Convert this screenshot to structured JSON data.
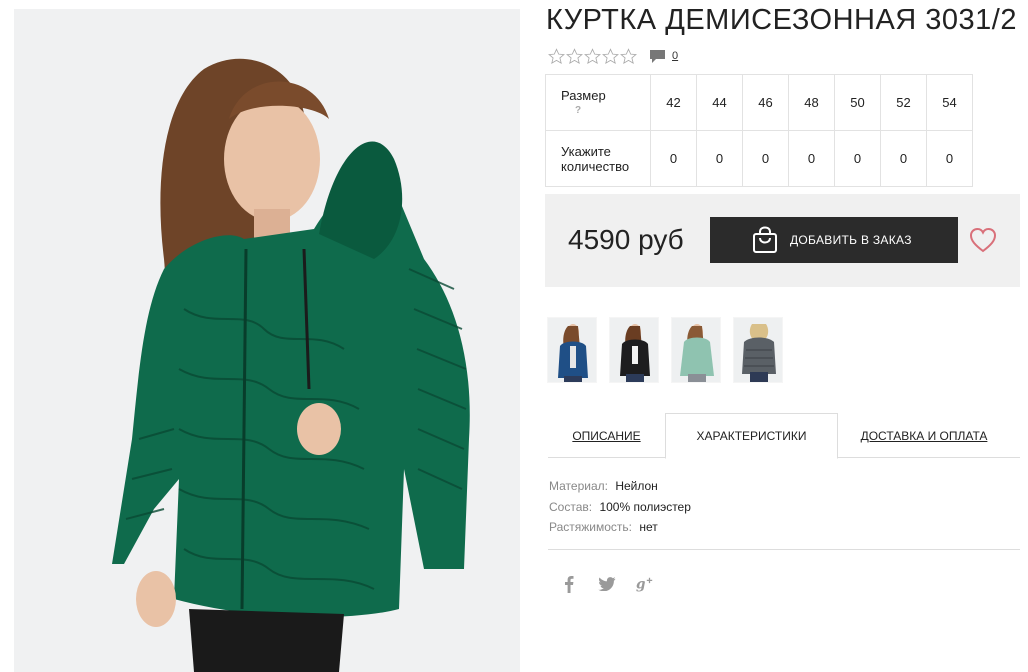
{
  "product": {
    "title": "КУРТКА ДЕМИСЕЗОННАЯ 3031/2",
    "comments_count": "0"
  },
  "sizes": {
    "size_label": "Размер",
    "size_hint": "?",
    "qty_label_line1": "Укажите",
    "qty_label_line2": "количество",
    "values": [
      "42",
      "44",
      "46",
      "48",
      "50",
      "52",
      "54"
    ],
    "quantities": [
      "0",
      "0",
      "0",
      "0",
      "0",
      "0",
      "0"
    ]
  },
  "price": {
    "amount": "4590 руб",
    "add_button_label": "ДОБАВИТЬ В ЗАКАЗ"
  },
  "tabs": {
    "description": "ОПИСАНИЕ",
    "characteristics": "ХАРАКТЕРИСТИКИ",
    "delivery": "ДОСТАВКА И ОПЛАТА"
  },
  "specs": [
    {
      "label": "Материал:",
      "value": "Нейлон"
    },
    {
      "label": "Состав:",
      "value": "100% полиэстер"
    },
    {
      "label": "Растяжимость:",
      "value": "нет"
    }
  ],
  "colors": {
    "jacket_green": "#0f6b4c",
    "jacket_green_dark": "#0a4a34",
    "button_dark": "#2b2b2b",
    "price_box_bg": "#f0f0f0",
    "heart": "#d9707a"
  },
  "icons": {
    "stars": [
      "star-outline-icon",
      "star-outline-icon",
      "star-outline-icon",
      "star-outline-icon",
      "star-outline-icon"
    ],
    "comment": "comment-bubble-icon",
    "bag": "shopping-bag-icon",
    "wishlist": "heart-outline-icon",
    "social": [
      "facebook-icon",
      "twitter-icon",
      "google-plus-icon"
    ]
  }
}
